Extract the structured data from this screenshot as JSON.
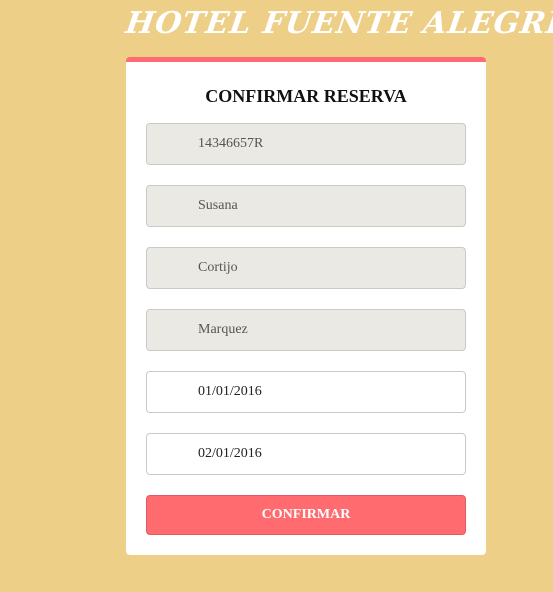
{
  "header": {
    "title": "HOTEL FUENTE ALEGRE"
  },
  "form": {
    "title": "CONFIRMAR RESERVA",
    "fields": [
      {
        "name": "dni",
        "value": "14346657R",
        "readonly": true
      },
      {
        "name": "nombre",
        "value": "Susana",
        "readonly": true
      },
      {
        "name": "apellido1",
        "value": "Cortijo",
        "readonly": true
      },
      {
        "name": "apellido2",
        "value": "Marquez",
        "readonly": true
      },
      {
        "name": "fecha-entrada",
        "value": "01/01/2016",
        "readonly": false
      },
      {
        "name": "fecha-salida",
        "value": "02/01/2016",
        "readonly": false
      }
    ],
    "submit_label": "CONFIRMAR"
  },
  "colors": {
    "background": "#edcf88",
    "accent": "#ff6b6f",
    "readonly_field": "#ebe9e3"
  }
}
